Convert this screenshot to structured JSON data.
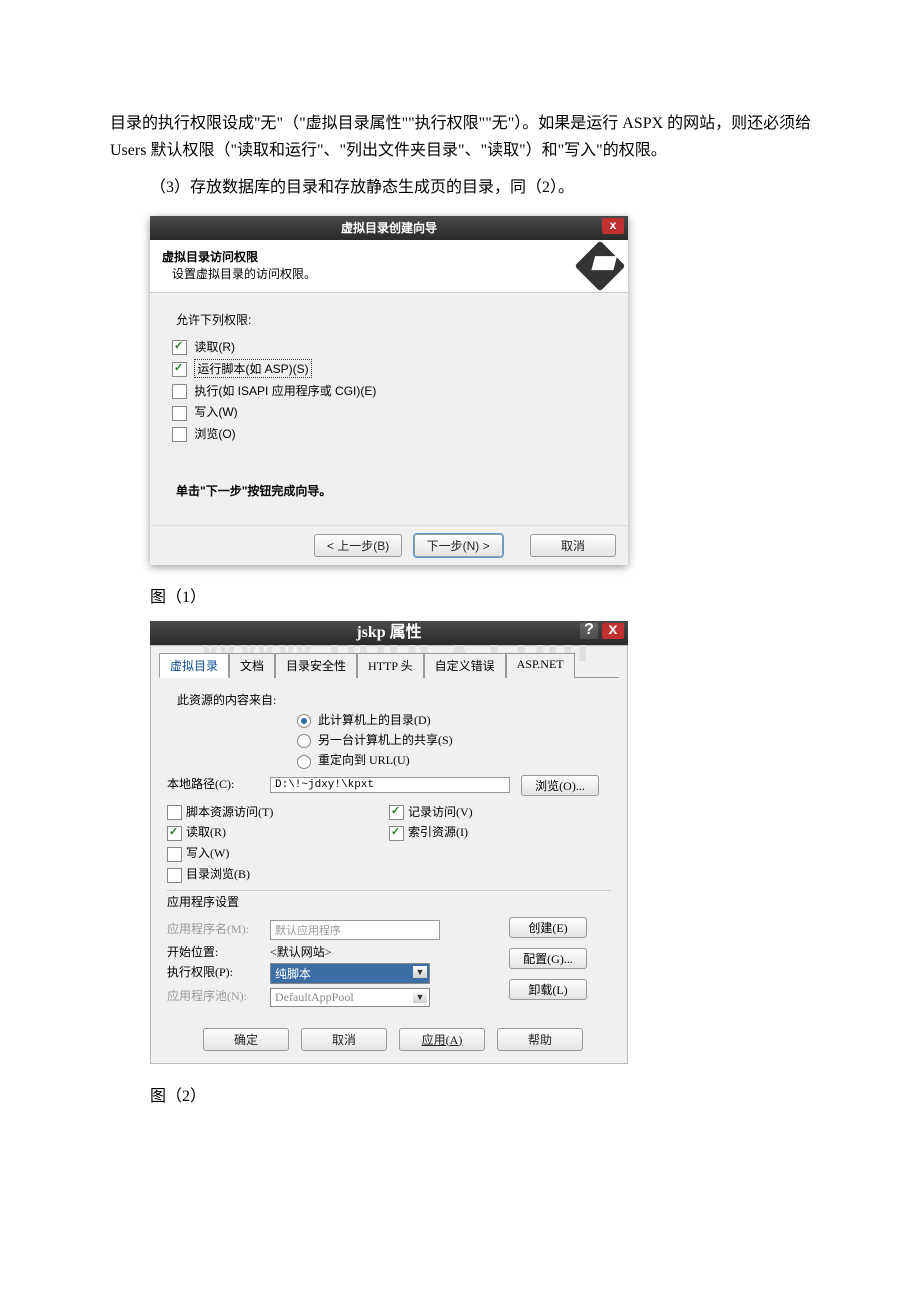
{
  "paragraph1": "目录的执行权限设成\"无\"（\"虚拟目录属性\"\"执行权限\"\"无\"）。如果是运行 ASPX 的网站，则还必须给 Users 默认权限（\"读取和运行\"、\"列出文件夹目录\"、\"读取\"）和\"写入\"的权限。",
  "paragraph2": "（3）存放数据库的目录和存放静态生成页的目录，同（2）。",
  "dialog1": {
    "title": "虚拟目录创建向导",
    "header_bold": "虚拟目录访问权限",
    "header_sub": "设置虚拟目录的访问权限。",
    "allow_label": "允许下列权限:",
    "checks": [
      {
        "label": "读取(R)",
        "checked": true
      },
      {
        "label": "运行脚本(如 ASP)(S)",
        "checked": true,
        "dotted": true
      },
      {
        "label": "执行(如 ISAPI 应用程序或 CGI)(E)",
        "checked": false
      },
      {
        "label": "写入(W)",
        "checked": false
      },
      {
        "label": "浏览(O)",
        "checked": false
      }
    ],
    "finish_hint": "单击\"下一步\"按钮完成向导。",
    "btn_back": "< 上一步(B)",
    "btn_next": "下一步(N) >",
    "btn_cancel": "取消"
  },
  "fig1": "图（1）",
  "watermark": "www.bdocx.com",
  "dialog2": {
    "title": "jskp 属性",
    "tabs": [
      "虚拟目录",
      "文档",
      "目录安全性",
      "HTTP 头",
      "自定义错误",
      "ASP.NET"
    ],
    "source_label": "此资源的内容来自:",
    "radios": [
      {
        "label": "此计算机上的目录(D)",
        "checked": true
      },
      {
        "label": "另一台计算机上的共享(S)",
        "checked": false
      },
      {
        "label": "重定向到 URL(U)",
        "checked": false
      }
    ],
    "local_path_label": "本地路径(C):",
    "local_path_value": "D:\\!~jdxy!\\kpxt",
    "browse_btn": "浏览(O)...",
    "check_left": [
      {
        "label": "脚本资源访问(T)",
        "checked": false
      },
      {
        "label": "读取(R)",
        "checked": true
      },
      {
        "label": "写入(W)",
        "checked": false
      },
      {
        "label": "目录浏览(B)",
        "checked": false
      }
    ],
    "check_right": [
      {
        "label": "记录访问(V)",
        "checked": true
      },
      {
        "label": "索引资源(I)",
        "checked": true
      }
    ],
    "app_section": "应用程序设置",
    "app_name_label": "应用程序名(M):",
    "app_name_value": "默认应用程序",
    "start_label": "开始位置:",
    "start_value": "<默认网站>",
    "exec_label": "执行权限(P):",
    "exec_value": "纯脚本",
    "pool_label": "应用程序池(N):",
    "pool_value": "DefaultAppPool",
    "btn_create": "创建(E)",
    "btn_config": "配置(G)...",
    "btn_unload": "卸载(L)",
    "btn_ok": "确定",
    "btn_cancel": "取消",
    "btn_apply": "应用(A)",
    "btn_help": "帮助"
  },
  "fig2": "图（2）"
}
